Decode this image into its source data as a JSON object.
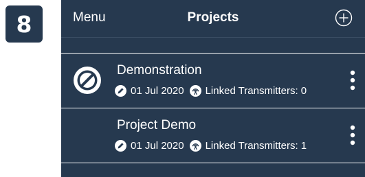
{
  "step_badge": "8",
  "nav": {
    "menu_label": "Menu",
    "title": "Projects",
    "add_icon": "plus-circle-icon"
  },
  "projects": [
    {
      "name": "Demonstration",
      "status_icon": "disabled-icon",
      "date": "01 Jul 2020",
      "linked_transmitters": "Linked Transmitters: 0"
    },
    {
      "name": "Project Demo",
      "status_icon": "",
      "date": "01 Jul 2020",
      "linked_transmitters": "Linked Transmitters: 1"
    }
  ],
  "colors": {
    "background": "#26394f",
    "text": "#ffffff"
  }
}
